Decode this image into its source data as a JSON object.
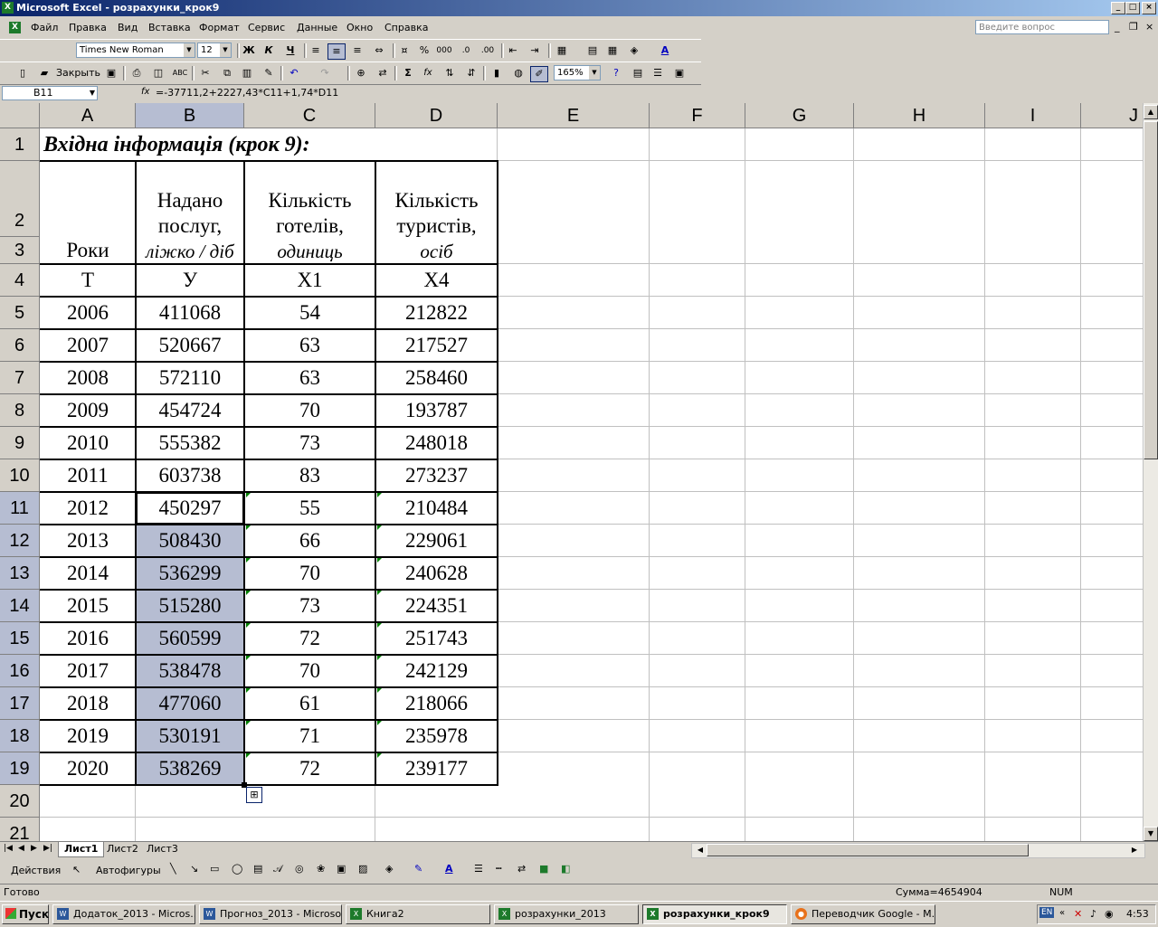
{
  "window": {
    "title": "Microsoft Excel - розрахунки_крок9"
  },
  "menu": {
    "items": [
      "Файл",
      "Правка",
      "Вид",
      "Вставка",
      "Формат",
      "Сервис",
      "Данные",
      "Окно",
      "Справка"
    ],
    "ask_placeholder": "Введите вопрос"
  },
  "toolbar": {
    "font": "Times New Roman",
    "size": "12",
    "close_label": "Закрыть",
    "zoom": "165%",
    "bold": "Ж",
    "italic": "К",
    "underline": "Ч",
    "percent": "%",
    "thousands": "000",
    "sum": "Σ",
    "fx": "fx"
  },
  "formula_bar": {
    "name_box": "B11",
    "fx_label": "fx",
    "formula": "=-37711,2+2227,43*C11+1,74*D11"
  },
  "columns": [
    "A",
    "B",
    "C",
    "D",
    "E",
    "F",
    "G",
    "H",
    "I",
    "J"
  ],
  "rows": [
    "1",
    "2",
    "3",
    "4",
    "5",
    "6",
    "7",
    "8",
    "9",
    "10",
    "11",
    "12",
    "13",
    "14",
    "15",
    "16",
    "17",
    "18",
    "19",
    "20",
    "21"
  ],
  "table": {
    "title": "Вхідна інформація (крок 9):",
    "headers": {
      "A": {
        "line1": "Роки"
      },
      "B": {
        "line1": "Надано",
        "line2": "послуг,",
        "line3": "ліжко / діб"
      },
      "C": {
        "line1": "Кількість",
        "line2": "готелів,",
        "line3": "одиниць"
      },
      "D": {
        "line1": "Кількість",
        "line2": "туристів,",
        "line3": "осіб"
      }
    },
    "symbols": [
      "Т",
      "У",
      "Х1",
      "Х4"
    ],
    "data": [
      [
        "2006",
        "411068",
        "54",
        "212822"
      ],
      [
        "2007",
        "520667",
        "63",
        "217527"
      ],
      [
        "2008",
        "572110",
        "63",
        "258460"
      ],
      [
        "2009",
        "454724",
        "70",
        "193787"
      ],
      [
        "2010",
        "555382",
        "73",
        "248018"
      ],
      [
        "2011",
        "603738",
        "83",
        "273237"
      ],
      [
        "2012",
        "450297",
        "55",
        "210484"
      ],
      [
        "2013",
        "508430",
        "66",
        "229061"
      ],
      [
        "2014",
        "536299",
        "70",
        "240628"
      ],
      [
        "2015",
        "515280",
        "73",
        "224351"
      ],
      [
        "2016",
        "560599",
        "72",
        "251743"
      ],
      [
        "2017",
        "538478",
        "70",
        "242129"
      ],
      [
        "2018",
        "477060",
        "61",
        "218066"
      ],
      [
        "2019",
        "530191",
        "71",
        "235978"
      ],
      [
        "2020",
        "538269",
        "72",
        "239177"
      ]
    ]
  },
  "sheets": [
    "Лист1",
    "Лист2",
    "Лист3"
  ],
  "drawing": {
    "actions": "Действия",
    "autoshapes": "Автофигуры"
  },
  "status": {
    "ready": "Готово",
    "sum": "Сумма=4654904",
    "num": "NUM"
  },
  "taskbar": {
    "start": "Пуск",
    "items": [
      "Додаток_2013 - Micros...",
      "Прогноз_2013 - Microso...",
      "Книга2",
      "розрахунки_2013",
      "розрахунки_крок9",
      "Переводчик Google - М..."
    ],
    "lang": "EN",
    "time": "4:53"
  },
  "colors": {
    "selection": "#b6bdd2",
    "title_start": "#0a246a",
    "title_end": "#a6caf0"
  }
}
